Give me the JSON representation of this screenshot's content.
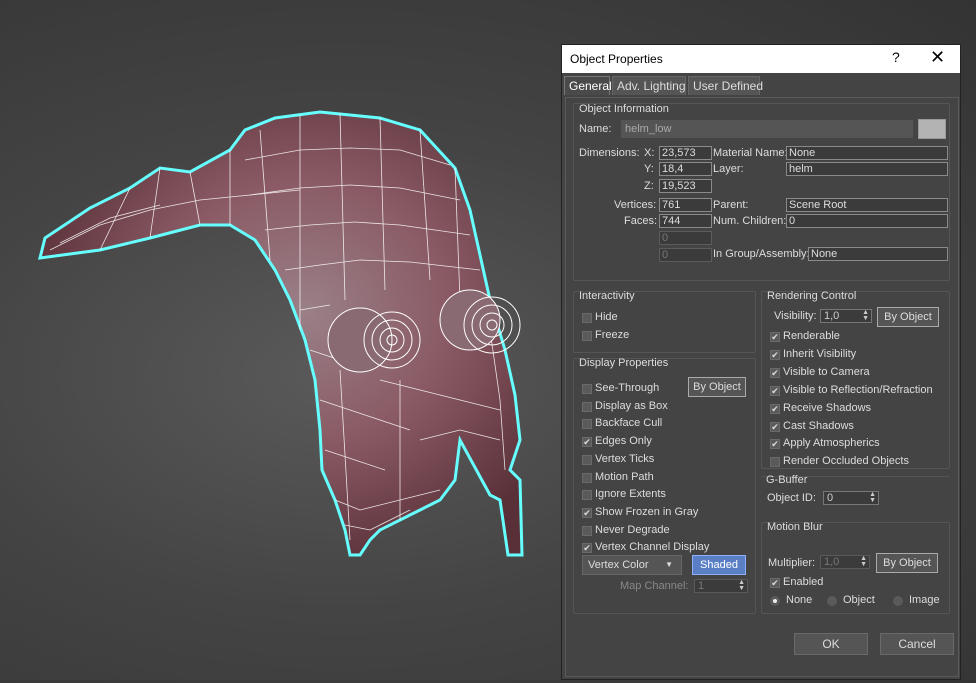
{
  "dialog": {
    "title": "Object Properties",
    "help": "?",
    "close": "✕"
  },
  "tabs": [
    "General",
    "Adv. Lighting",
    "User Defined"
  ],
  "object_info": {
    "title": "Object Information",
    "name_label": "Name:",
    "name_value": "helm_low",
    "dimensions_label": "Dimensions:",
    "x_label": "X:",
    "x": "23,573",
    "y_label": "Y:",
    "y": "18,4",
    "z_label": "Z:",
    "z": "19,523",
    "vertices_label": "Vertices:",
    "vertices": "761",
    "faces_label": "Faces:",
    "faces": "744",
    "extra1": "0",
    "extra2": "0",
    "material_label": "Material Name:",
    "material": "None",
    "layer_label": "Layer:",
    "layer": "helm",
    "parent_label": "Parent:",
    "parent": "Scene Root",
    "children_label": "Num. Children:",
    "children": "0",
    "group_label": "In Group/Assembly:",
    "group": "None"
  },
  "interactivity": {
    "title": "Interactivity",
    "hide": "Hide",
    "freeze": "Freeze"
  },
  "display": {
    "title": "Display Properties",
    "by_object": "By Object",
    "items": [
      "See-Through",
      "Display as Box",
      "Backface Cull",
      "Edges Only",
      "Vertex Ticks",
      "Motion Path",
      "Ignore Extents",
      "Show Frozen in Gray",
      "Never Degrade",
      "Vertex Channel Display"
    ],
    "checked": [
      false,
      false,
      false,
      true,
      false,
      false,
      false,
      true,
      false,
      true
    ],
    "vertex_color": "Vertex Color",
    "shaded": "Shaded",
    "map_channel_label": "Map Channel:",
    "map_channel": "1"
  },
  "rendering": {
    "title": "Rendering Control",
    "visibility_label": "Visibility:",
    "visibility": "1,0",
    "by_object": "By Object",
    "items": [
      "Renderable",
      "Inherit Visibility",
      "Visible to Camera",
      "Visible to Reflection/Refraction",
      "Receive Shadows",
      "Cast Shadows",
      "Apply Atmospherics",
      "Render Occluded Objects"
    ],
    "checked": [
      true,
      true,
      true,
      true,
      true,
      true,
      true,
      false
    ]
  },
  "gbuffer": {
    "title": "G-Buffer",
    "object_id_label": "Object ID:",
    "object_id": "0"
  },
  "motion_blur": {
    "title": "Motion Blur",
    "multiplier_label": "Multiplier:",
    "multiplier": "1,0",
    "by_object": "By Object",
    "enabled": "Enabled",
    "none": "None",
    "object": "Object",
    "image": "Image"
  },
  "buttons": {
    "ok": "OK",
    "cancel": "Cancel"
  },
  "icons": [
    "check-icon",
    "spinner-arrows-icon",
    "dropdown-arrow-icon",
    "close-icon",
    "help-icon"
  ]
}
